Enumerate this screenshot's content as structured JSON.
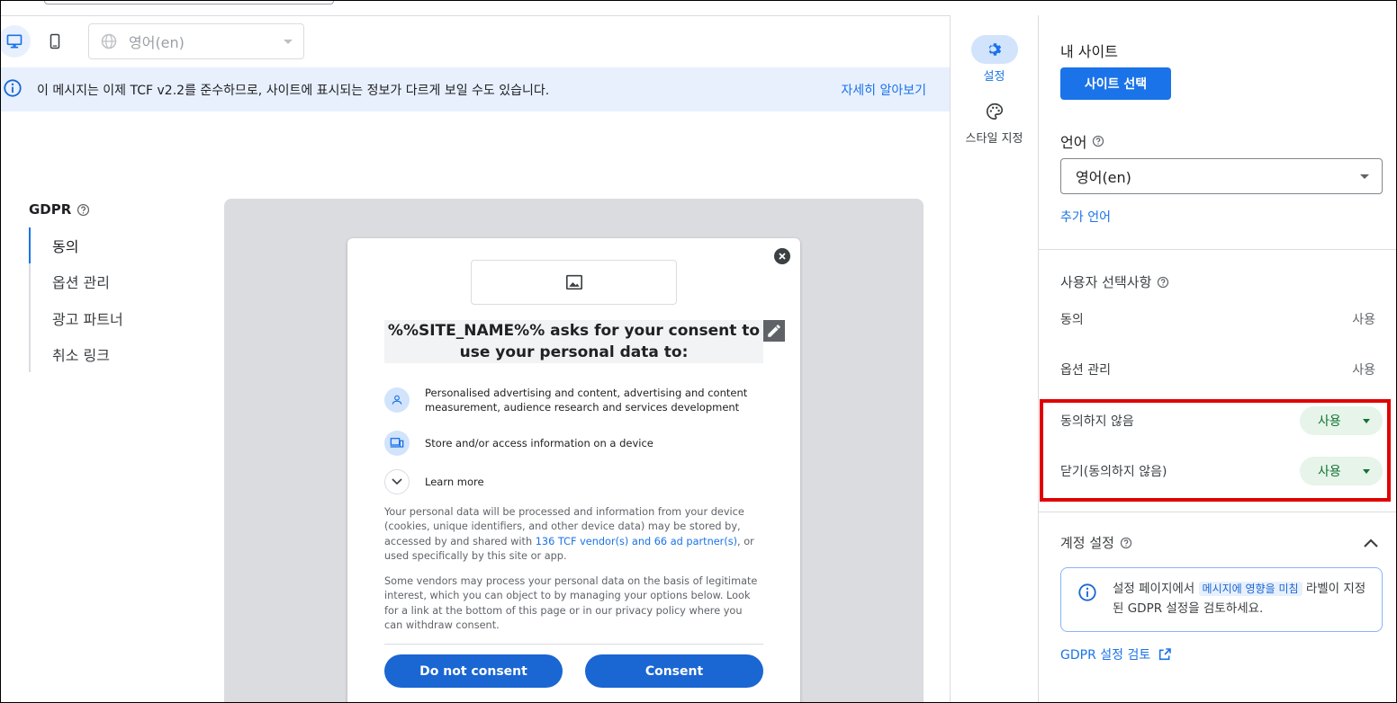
{
  "toolbar": {
    "language_select_value": "영어(en)"
  },
  "banner": {
    "message": "이 메시지는 이제 TCF v2.2를 준수하므로, 사이트에 표시되는 정보가 다르게 보일 수도 있습니다.",
    "learn_more": "자세히 알아보기"
  },
  "left_nav": {
    "title": "GDPR",
    "items": [
      {
        "label": "동의"
      },
      {
        "label": "옵션 관리"
      },
      {
        "label": "광고 파트너"
      },
      {
        "label": "취소 링크"
      }
    ]
  },
  "dialog": {
    "headline": "%%SITE_NAME%% asks for your consent to use your personal data to:",
    "purpose_1": "Personalised advertising and content, advertising and content measurement, audience research and services development",
    "purpose_2": "Store and/or access information on a device",
    "learn_more": "Learn more",
    "para1_before": "Your personal data will be processed and information from your device (cookies, unique identifiers, and other device data) may be stored by, accessed by and shared with ",
    "para1_link": "136 TCF vendor(s) and 66 ad partner(s)",
    "para1_after": ", or used specifically by this site or app.",
    "para2": "Some vendors may process your personal data on the basis of legitimate interest, which you can object to by managing your options below. Look for a link at the bottom of this page or in our privacy policy where you can withdraw consent.",
    "do_not_consent": "Do not consent",
    "consent": "Consent"
  },
  "rail": {
    "settings": "설정",
    "styling": "스타일 지정"
  },
  "right_panel": {
    "my_sites": "내 사이트",
    "select_site": "사이트 선택",
    "language_label": "언어",
    "language_value": "영어(en)",
    "add_language": "추가 언어",
    "user_choices_title": "사용자 선택사항",
    "choices": [
      {
        "label": "동의",
        "value": "사용"
      },
      {
        "label": "옵션 관리",
        "value": "사용"
      },
      {
        "label": "동의하지 않음",
        "value": "사용"
      },
      {
        "label": "닫기(동의하지 않음)",
        "value": "사용"
      }
    ],
    "account_settings_title": "계정 설정",
    "notice_before": "설정 페이지에서 ",
    "notice_tag": "메시지에 영향을 미침",
    "notice_after": " 라벨이 지정된 GDPR 설정을 검토하세요.",
    "review_link": "GDPR 설정 검토"
  },
  "colors": {
    "accent": "#1a73e8",
    "highlight_border": "#e00000",
    "chip_bg": "#e6f4ea",
    "chip_text": "#137333"
  }
}
